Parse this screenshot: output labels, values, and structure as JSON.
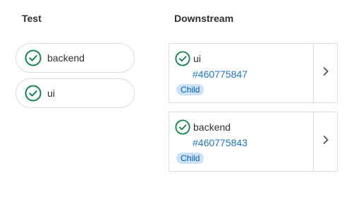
{
  "stages": {
    "test": {
      "title": "Test",
      "jobs": [
        {
          "name": "backend",
          "status": "success",
          "icon": "status-success-icon"
        },
        {
          "name": "ui",
          "status": "success",
          "icon": "status-success-icon"
        }
      ]
    },
    "downstream": {
      "title": "Downstream",
      "pipelines": [
        {
          "name": "ui",
          "id_text": "#460775847",
          "badge": "Child",
          "status": "success",
          "expand_icon": "chevron-right-icon"
        },
        {
          "name": "backend",
          "id_text": "#460775843",
          "badge": "Child",
          "status": "success",
          "expand_icon": "chevron-right-icon"
        }
      ]
    }
  },
  "colors": {
    "success": "#108548",
    "link": "#1f75cb",
    "badge_bg": "#cbe2f9",
    "badge_text": "#0b5cad",
    "border": "#dcdcde"
  }
}
